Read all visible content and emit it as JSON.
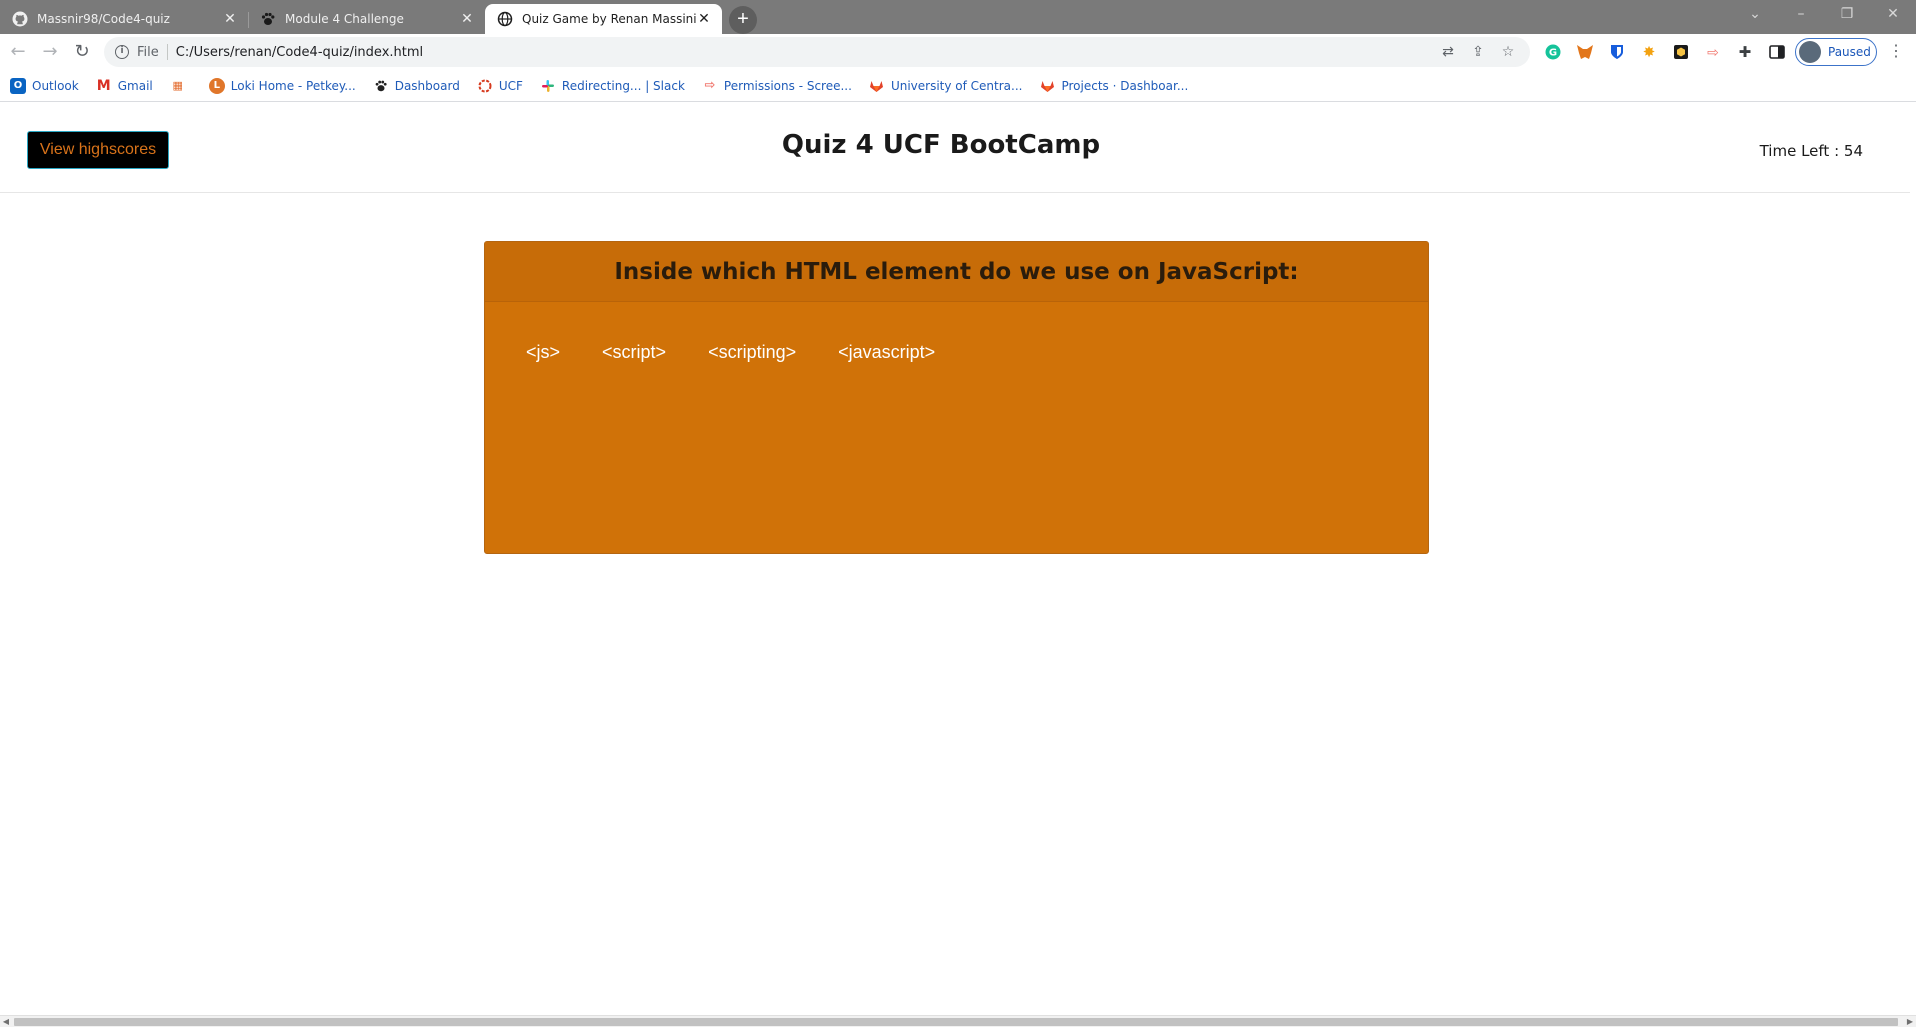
{
  "browser": {
    "tabs": [
      {
        "title": "Massnir98/Code4-quiz",
        "icon": "github-icon",
        "active": false
      },
      {
        "title": "Module 4 Challenge",
        "icon": "pawprint-icon",
        "active": false
      },
      {
        "title": "Quiz Game by Renan Massini",
        "icon": "globe-icon",
        "active": true
      }
    ],
    "address": {
      "scheme": "File",
      "url": "C:/Users/renan/Code4-quiz/index.html"
    },
    "profile_status": "Paused",
    "bookmarks": [
      {
        "label": "Outlook",
        "icon": "outlook-icon",
        "color": "#0a64c2"
      },
      {
        "label": "Gmail",
        "icon": "gmail-icon",
        "color": "#d93025"
      },
      {
        "label": "",
        "icon": "webcourses-icon",
        "color": "#e36b2c"
      },
      {
        "label": "Loki Home - Petkey...",
        "icon": "loki-icon",
        "color": "#e0762a"
      },
      {
        "label": "Dashboard",
        "icon": "pawprint-icon",
        "color": "#222222"
      },
      {
        "label": "UCF",
        "icon": "ucf-icon",
        "color": "#d63a1e"
      },
      {
        "label": "Redirecting... | Slack",
        "icon": "slack-icon",
        "color": "#4a154b"
      },
      {
        "label": "Permissions - Scree...",
        "icon": "permissions-icon",
        "color": "#f0776e"
      },
      {
        "label": "University of Centra...",
        "icon": "gitlab-icon",
        "color": "#e2432a"
      },
      {
        "label": "Projects · Dashboar...",
        "icon": "gitlab-icon",
        "color": "#e2432a"
      }
    ]
  },
  "app": {
    "highscores_label": "View highscores",
    "title": "Quiz 4 UCF BootCamp",
    "timer_label": "Time Left : ",
    "timer_value": "54"
  },
  "quiz": {
    "question": "Inside which HTML element do we use on JavaScript:",
    "choices": [
      "<js>",
      "<script>",
      "<scripting>",
      "<javascript>"
    ]
  },
  "colors": {
    "card": "#d07208",
    "card_header": "#c76c08",
    "button_bg": "#000000",
    "button_text": "#d9731a",
    "button_border": "#2aa8c4"
  }
}
